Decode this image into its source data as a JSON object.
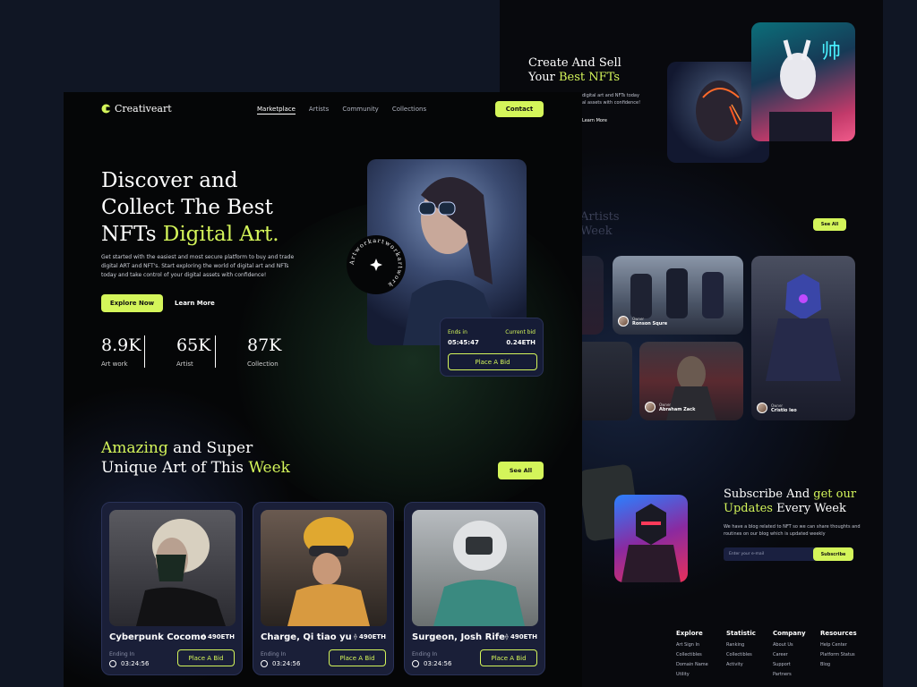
{
  "brand": {
    "name": "Creativeart"
  },
  "nav": {
    "items": [
      "Marketplace",
      "Artists",
      "Community",
      "Collections"
    ],
    "contact": "Contact"
  },
  "hero": {
    "line1": "Discover and",
    "line2": "Collect The Best",
    "line3a": "NFTs ",
    "line3b": "Digital Art.",
    "desc1": "Get started with the easiest and most secure platform to buy and trade",
    "desc2": "digital ART and NFT's. Start exploring the world of digital art and NFTs",
    "desc3": "today and take control of your digital assets with confidence!",
    "explore": "Explore Now",
    "learn": "Learn More",
    "badge_text": "Artworkartworkartwork",
    "stats": [
      {
        "value": "8.9K",
        "label": "Art work"
      },
      {
        "value": "65K",
        "label": "Artist"
      },
      {
        "value": "87K",
        "label": "Collection"
      }
    ],
    "bid": {
      "ends_label": "Ends in",
      "ends_value": "05:45:47",
      "current_label": "Current bid",
      "current_value": "0.24ETH",
      "button": "Place A Bid"
    }
  },
  "weekly": {
    "title_a": "Amazing",
    "title_b": " and Super",
    "title_c": "Unique Art of This ",
    "title_d": "Week",
    "see_all": "See All",
    "cards": [
      {
        "name": "Cyberpunk Cocomo",
        "price": "490ETH",
        "ending_label": "Ending In",
        "time": "03:24:56",
        "button": "Place A Bid"
      },
      {
        "name": "Charge, Qi tiao yu",
        "price": "490ETH",
        "ending_label": "Ending In",
        "time": "03:24:56",
        "button": "Place A Bid"
      },
      {
        "name": "Surgeon, Josh Rife",
        "price": "490ETH",
        "ending_label": "Ending In",
        "time": "03:24:56",
        "button": "Place A Bid"
      }
    ]
  },
  "back": {
    "create_line1": "Create And Sell",
    "create_line2a": "Your ",
    "create_line2b": "Best NFTs",
    "create_desc1": "digital art and NFTs today",
    "create_desc2": "al assets with confidence!",
    "learn_more": "Learn More",
    "artists_a": "Artists",
    "artists_b": "Week",
    "see_all": "See All",
    "owners": [
      {
        "label": "Owner",
        "name": "Ronson Squre"
      },
      {
        "label": "Owner",
        "name": "Abraham Zack"
      },
      {
        "label": "Owner",
        "name": "Cristio leo"
      }
    ],
    "subscribe_line1": "Subscribe And ",
    "subscribe_line1b": "get our",
    "subscribe_line2a": "Updates",
    "subscribe_line2b": " Every Week",
    "subscribe_desc1": "We have a blog related to NFT so we can share thoughts and",
    "subscribe_desc2": "routines on our blog which is updated weekly",
    "email_placeholder": "Enter your e-mail",
    "subscribe_button": "Subscribe",
    "footer": [
      {
        "title": "Explore",
        "items": [
          "Art Sign In",
          "Collectibles",
          "Domain Name",
          "Utility"
        ]
      },
      {
        "title": "Statistic",
        "items": [
          "Ranking",
          "Collectibles",
          "Activity"
        ]
      },
      {
        "title": "Company",
        "items": [
          "About Us",
          "Career",
          "Support",
          "Partners"
        ]
      },
      {
        "title": "Resources",
        "items": [
          "Help Center",
          "Platform Status",
          "Blog"
        ]
      }
    ]
  },
  "colors": {
    "accent": "#d4f55a",
    "card": "#1a1f38",
    "page": "#050607"
  }
}
